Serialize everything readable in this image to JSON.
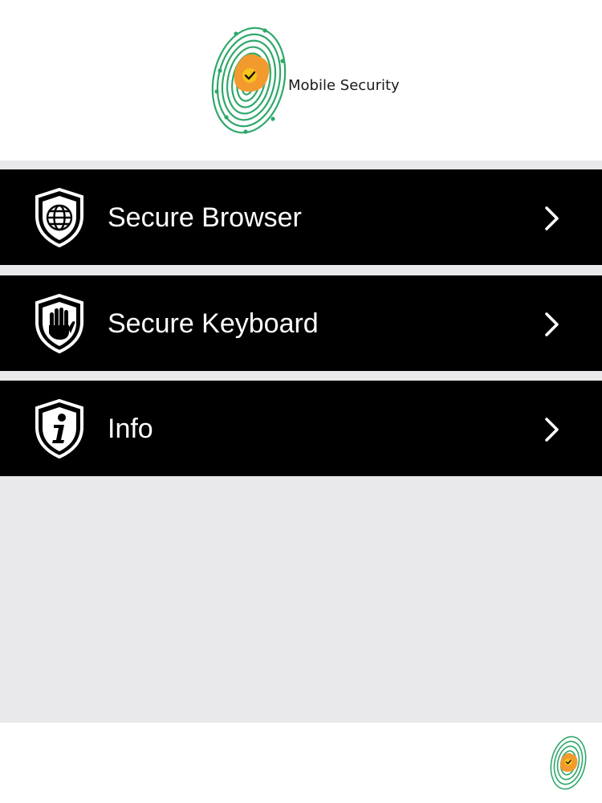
{
  "header": {
    "logo_text": "Mobile Security",
    "logo_icon": "fingerprint-shield-logo",
    "colors": {
      "fingerprint": "#2fa86a",
      "badge": "#f29a2e",
      "check": "#111111"
    }
  },
  "menu": {
    "items": [
      {
        "label": "Secure Browser",
        "icon": "shield-globe-icon"
      },
      {
        "label": "Secure Keyboard",
        "icon": "shield-hand-icon"
      },
      {
        "label": "Info",
        "icon": "shield-info-icon"
      }
    ],
    "chevron_icon": "chevron-right-icon",
    "colors": {
      "item_background": "#000000",
      "item_text": "#ffffff",
      "separator": "#e9e8ea"
    }
  },
  "footer": {
    "logo_icon": "fingerprint-logo-small"
  }
}
